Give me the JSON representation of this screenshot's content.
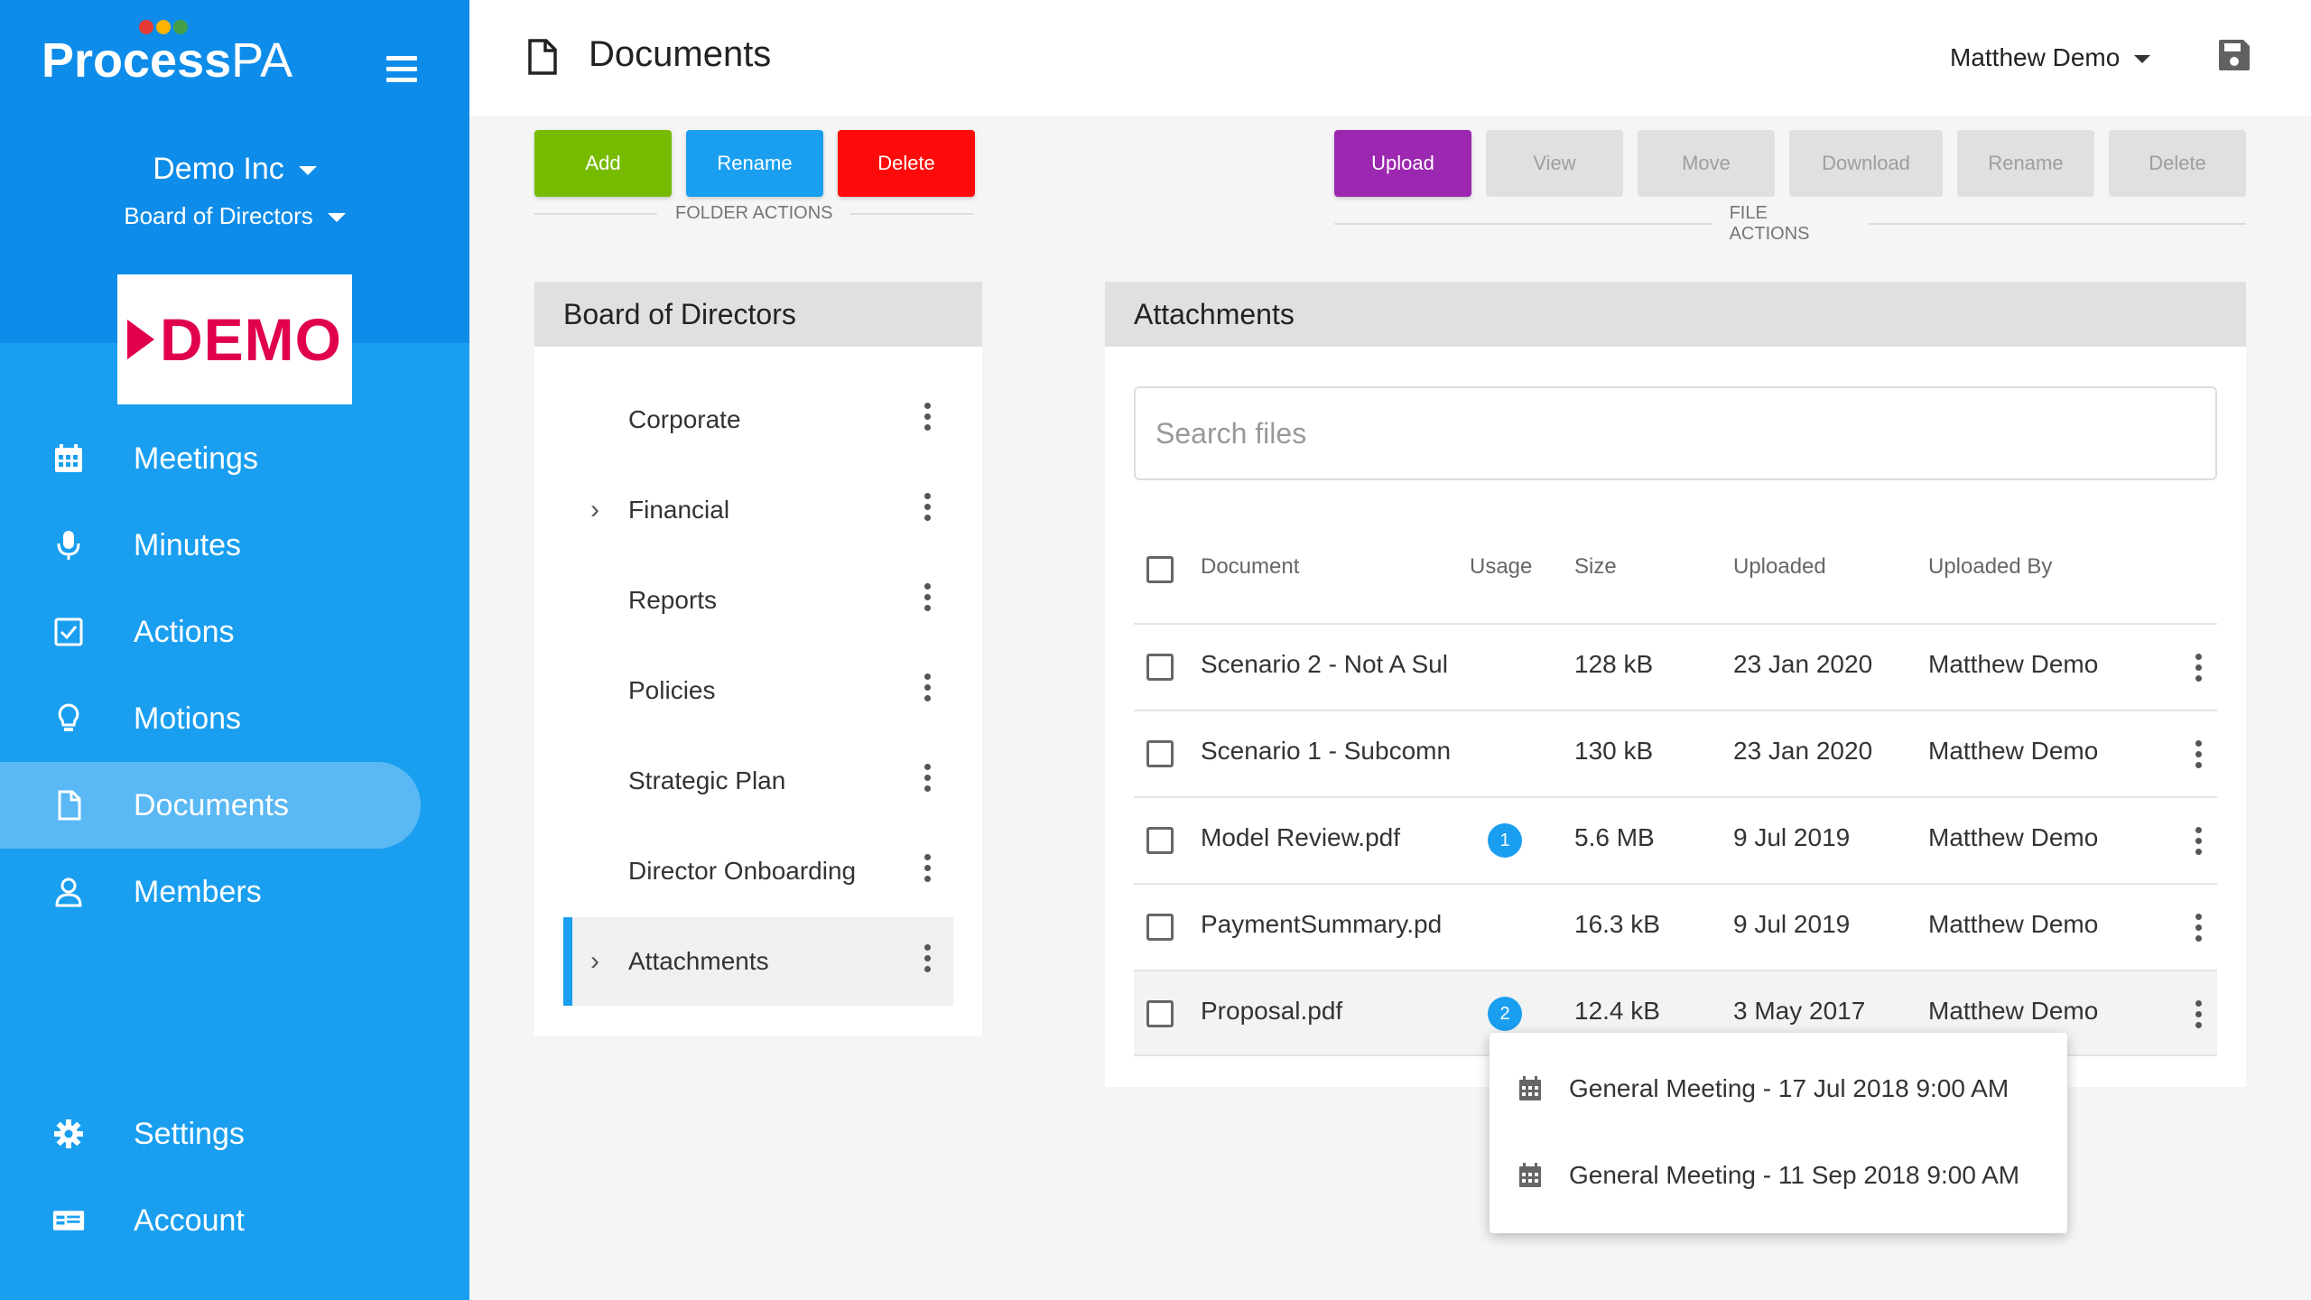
{
  "app": {
    "brand_main": "Process",
    "brand_suffix": "PA"
  },
  "colors": {
    "sidebar": "#1a9ff0",
    "accent": "#1a9ff0",
    "add": "#77bb00",
    "rename": "#1a9ff0",
    "delete": "#ff0a0a",
    "upload": "#9c27b0"
  },
  "org": {
    "company": "Demo Inc",
    "board": "Board of Directors",
    "logo_text": "DEMO"
  },
  "nav": {
    "items": [
      {
        "label": "Meetings",
        "icon": "calendar-icon"
      },
      {
        "label": "Minutes",
        "icon": "microphone-icon"
      },
      {
        "label": "Actions",
        "icon": "checkbox-icon"
      },
      {
        "label": "Motions",
        "icon": "lightbulb-icon"
      },
      {
        "label": "Documents",
        "icon": "document-icon",
        "active": true
      },
      {
        "label": "Members",
        "icon": "person-icon"
      }
    ],
    "bottom": [
      {
        "label": "Settings",
        "icon": "gear-icon"
      },
      {
        "label": "Account",
        "icon": "id-card-icon"
      }
    ]
  },
  "header": {
    "title": "Documents",
    "user": "Matthew Demo"
  },
  "toolbar": {
    "folder_actions_label": "FOLDER ACTIONS",
    "file_actions_label": "FILE ACTIONS",
    "add": "Add",
    "rename": "Rename",
    "delete": "Delete",
    "upload": "Upload",
    "view": "View",
    "move": "Move",
    "download": "Download",
    "file_rename": "Rename",
    "file_delete": "Delete"
  },
  "folders": {
    "title": "Board of Directors",
    "items": [
      {
        "name": "Corporate"
      },
      {
        "name": "Financial",
        "expandable": true
      },
      {
        "name": "Reports"
      },
      {
        "name": "Policies"
      },
      {
        "name": "Strategic Plan"
      },
      {
        "name": "Director Onboarding"
      },
      {
        "name": "Attachments",
        "expandable": true,
        "active": true
      }
    ]
  },
  "files": {
    "title": "Attachments",
    "search_placeholder": "Search files",
    "columns": {
      "document": "Document",
      "usage": "Usage",
      "size": "Size",
      "uploaded": "Uploaded",
      "uploaded_by": "Uploaded By"
    },
    "rows": [
      {
        "document": "Scenario 2 - Not A Sul",
        "usage": "",
        "size": "128 kB",
        "uploaded": "23 Jan 2020",
        "uploaded_by": "Matthew Demo"
      },
      {
        "document": "Scenario 1 - Subcomn",
        "usage": "",
        "size": "130 kB",
        "uploaded": "23 Jan 2020",
        "uploaded_by": "Matthew Demo"
      },
      {
        "document": "Model Review.pdf",
        "usage": "1",
        "size": "5.6 MB",
        "uploaded": "9 Jul 2019",
        "uploaded_by": "Matthew Demo"
      },
      {
        "document": "PaymentSummary.pd",
        "usage": "",
        "size": "16.3 kB",
        "uploaded": "9 Jul 2019",
        "uploaded_by": "Matthew Demo"
      },
      {
        "document": "Proposal.pdf",
        "usage": "2",
        "size": "12.4 kB",
        "uploaded": "3 May 2017",
        "uploaded_by": "Matthew Demo"
      }
    ]
  },
  "usage_popup": {
    "items": [
      {
        "label": "General Meeting - 17 Jul 2018 9:00 AM"
      },
      {
        "label": "General Meeting - 11 Sep 2018 9:00 AM"
      }
    ]
  }
}
